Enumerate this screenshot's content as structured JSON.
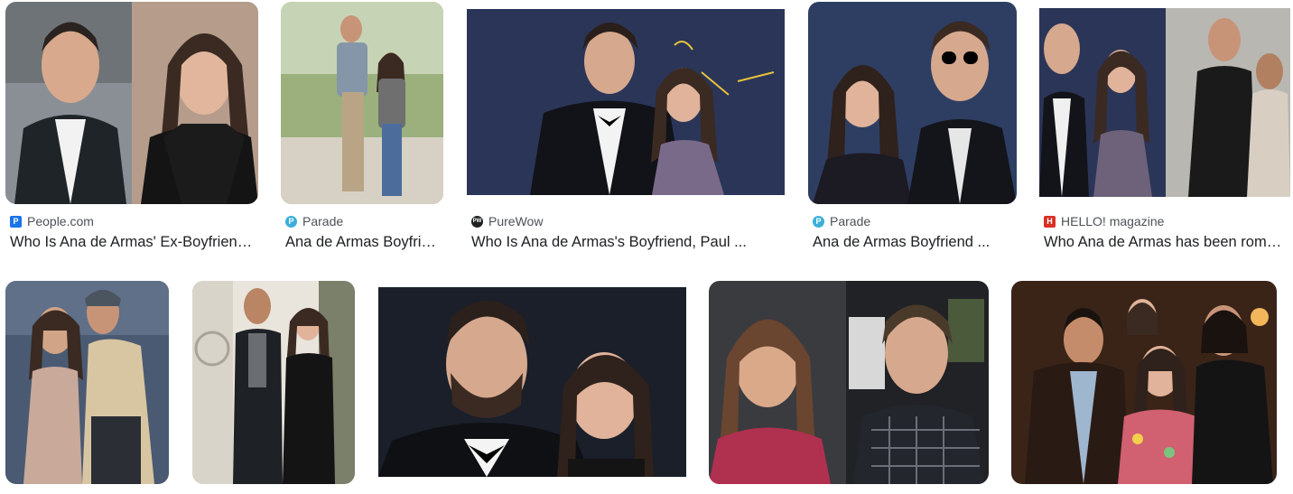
{
  "row1": [
    {
      "source": "People.com",
      "favicon": "people-favicon",
      "title": "Who Is Ana de Armas' Ex-Boyfriend ..."
    },
    {
      "source": "Parade",
      "favicon": "parade-favicon",
      "title": "Ana de Armas Boyfriend ..."
    },
    {
      "source": "PureWow",
      "favicon": "purewow-favicon",
      "title": "Who Is Ana de Armas's Boyfriend, Paul ..."
    },
    {
      "source": "Parade",
      "favicon": "parade-favicon",
      "title": "Ana de Armas Boyfriend ..."
    },
    {
      "source": "HELLO! magazine",
      "favicon": "hello-favicon",
      "title": "Who Ana de Armas has been romantically ..."
    }
  ],
  "favicon_glyphs": {
    "people": "P",
    "parade": "P",
    "purewow": "PW",
    "hello": "H"
  },
  "colors": {
    "text": "#202124",
    "source_text": "#4d5156",
    "people": "#1a73e8",
    "parade": "#3ab0d9",
    "purewow": "#202124",
    "hello": "#d93025"
  }
}
